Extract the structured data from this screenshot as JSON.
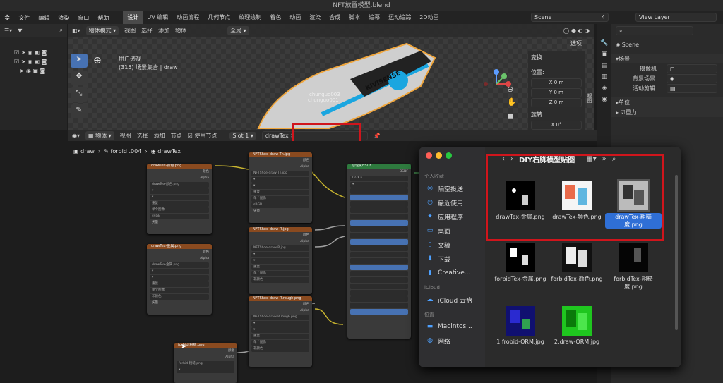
{
  "window_title": "NFT放置模型.blend",
  "menus": [
    "文件",
    "编辑",
    "渲染",
    "窗口",
    "帮助"
  ],
  "workspaces": [
    "设计",
    "UV 编辑",
    "动画流程",
    "几何节点",
    "纹理绘制",
    "着色",
    "动画",
    "渲染",
    "合成",
    "脚本",
    "追幕",
    "运动追踪",
    "2D动画"
  ],
  "scene": {
    "label": "Scene",
    "count": "4",
    "viewlayer": "View Layer"
  },
  "viewport": {
    "mode": "物体模式",
    "menus": [
      "视图",
      "选择",
      "添加",
      "物体"
    ],
    "orientation": "全局",
    "overlay_title": "用户透视",
    "collection": "(315) 场景集合 | draw",
    "options": "选项",
    "obj_label1": "chunguo003",
    "obj_label2": "chunguo001",
    "brand": "KIVISENSE"
  },
  "transform": {
    "title": "变换",
    "location": "位置:",
    "x": "0 m",
    "y": "0 m",
    "z": "0 m",
    "rotation": "旋转:",
    "rx": "0°",
    "x_lbl": "X",
    "y_lbl": "Y",
    "z_lbl": "Z",
    "side_tab": "视图"
  },
  "node_editor": {
    "type": "物体",
    "menus": [
      "视图",
      "选择",
      "添加",
      "节点"
    ],
    "use_nodes": "使用节点",
    "slot": "Slot 1",
    "material": "drawTex",
    "breadcrumb": [
      "draw",
      "forbid .004",
      "drawTex"
    ]
  },
  "nodes": {
    "tex1": "drawTex-颜色.png",
    "tex2": "drawTex-金属.png",
    "tex3": "forbid-粗糙.png",
    "tex4": "NFTShoe-draw-Tn.jpg",
    "tex5": "NFTShoe-draw-R.jpg",
    "tex6": "NFTShoe-draw-R.rough.png",
    "bsdf": "原理化BSDF",
    "bsdf_out": "BSDF",
    "color": "颜色",
    "alpha": "Alpha",
    "srgb": "sRGB",
    "linear": "线性",
    "vector": "矢量",
    "repeat": "重复",
    "single": "单个图像",
    "nonraw": "非颜色"
  },
  "finder": {
    "title": "DIY右脚模型贴图",
    "sections": {
      "fav": "个人收藏",
      "icloud": "iCloud",
      "loc": "位置"
    },
    "sidebar": [
      "隔空投送",
      "最近使用",
      "应用程序",
      "桌面",
      "文稿",
      "下载",
      "Creative...",
      "iCloud 云盘",
      "Macintos...",
      "网络"
    ],
    "files": [
      "drawTex-金属.png",
      "drawTex-颜色.png",
      "drawTex-粗糙度.png",
      "forbidTex-金属.png",
      "forbidTex-颜色.png",
      "forbidTex-粗糙度.png",
      "1.frobid-ORM.jpg",
      "2.draw-ORM.jpg"
    ]
  },
  "props": {
    "scene": "Scene",
    "section": "场景",
    "camera": "摄像机",
    "bg_scene": "背景场景",
    "active_clip": "活动剪辑",
    "units": "单位",
    "gravity": "重力"
  },
  "colors": {
    "accent": "#4772b3",
    "highlight": "#d0151c",
    "finder_sel": "#2f6fd6"
  }
}
